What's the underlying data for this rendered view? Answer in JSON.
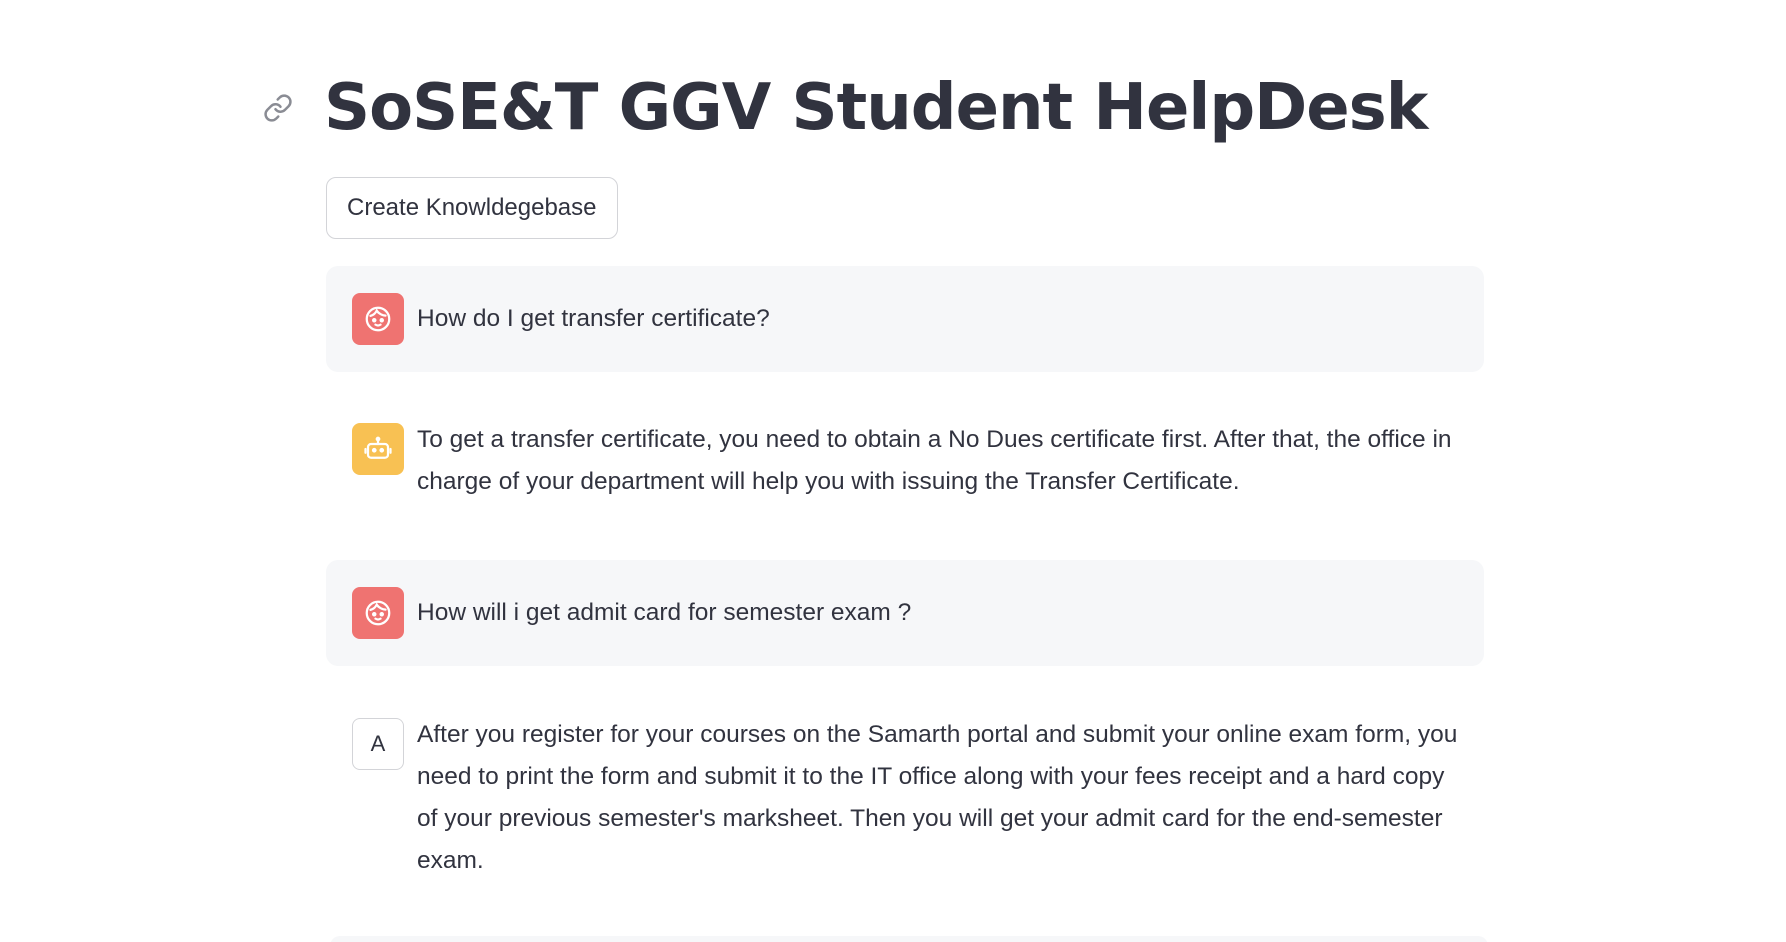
{
  "header": {
    "title": "SoSE&T GGV Student HelpDesk"
  },
  "toolbar": {
    "create_label": "Create Knowldegebase"
  },
  "messages": [
    {
      "role": "user",
      "avatar": "user-face-icon",
      "text": "How do I get transfer certificate?"
    },
    {
      "role": "assistant",
      "avatar": "robot-icon",
      "text": "To get a transfer certificate, you need to obtain a No Dues certificate first. After that, the office in charge of your department will help you with issuing the Transfer Certificate."
    },
    {
      "role": "user",
      "avatar": "user-face-icon",
      "text": "How will i get admit card for semester exam ?"
    },
    {
      "role": "assistant",
      "avatar_letter": "A",
      "text": "After you register for your courses on the Samarth portal and submit your online exam form, you need to print the form and submit it to the IT office along with your fees receipt and a hard copy of your previous semester's marksheet. Then you will get your admit card for the end-semester exam."
    }
  ],
  "colors": {
    "user_avatar": "#ef7371",
    "bot_avatar": "#f8c153",
    "user_bubble": "#f6f7f9",
    "text": "#31333f"
  }
}
